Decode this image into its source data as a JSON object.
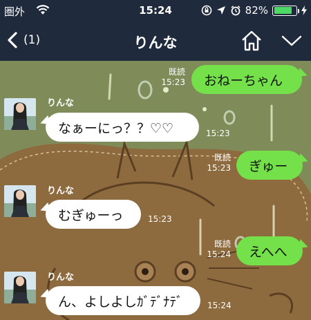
{
  "status": {
    "carrier": "圏外",
    "time": "15:24",
    "battery": "82%",
    "battery_level": 0.82
  },
  "header": {
    "back_count": "(1)",
    "title": "りんな"
  },
  "colors": {
    "header_bg": "#1f2a3d",
    "outgoing_bubble": "#74e14b",
    "incoming_bubble": "#ffffff",
    "chat_bg": "#7f8c59"
  },
  "messages": [
    {
      "side": "out",
      "text": "おねーちゃん",
      "read": "既読",
      "time": "15:23"
    },
    {
      "side": "in",
      "sender": "りんな",
      "text": "なぁーにっ？？♡♡",
      "time": "15:23"
    },
    {
      "side": "out",
      "text": "ぎゅー",
      "read": "既読",
      "time": "15:23"
    },
    {
      "side": "in",
      "sender": "りんな",
      "text": "むぎゅーっ",
      "time": "15:23"
    },
    {
      "side": "out",
      "text": "えへへ",
      "read": "既読",
      "time": "15:24"
    },
    {
      "side": "in",
      "sender": "りんな",
      "text": "ん、よしよしｶﾞﾃﾞﾅﾃﾞ",
      "time": "15:24"
    }
  ]
}
